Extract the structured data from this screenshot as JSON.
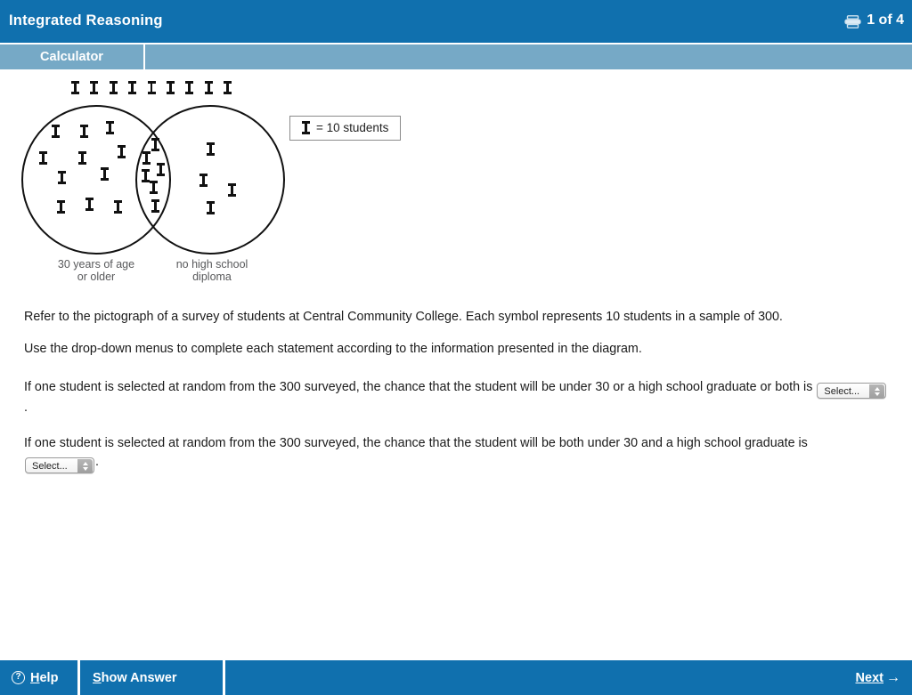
{
  "header": {
    "title": "Integrated Reasoning",
    "printer_icon": "printer-icon",
    "page_counter": "1 of 4"
  },
  "tabbar": {
    "tabs": [
      {
        "label": "Calculator",
        "active": true
      }
    ]
  },
  "pictograph": {
    "legend_symbol": "student-symbol-icon",
    "legend_text": "= 10 students",
    "left_label": "30 years of age\nor older",
    "left_label_line1": "30 years of age",
    "left_label_line2": "or older",
    "right_label_line1": "no high school",
    "right_label_line2": "diploma",
    "counts": {
      "outside_both": 9,
      "left_only": 11,
      "intersection": 6,
      "right_only": 4
    }
  },
  "chart_data": {
    "type": "pie",
    "title": "Survey of students at Central Community College",
    "subtitle": "Each symbol represents 10 students in a sample of 300",
    "symbol_value": 10,
    "total_students": 300,
    "categories": [
      "30 years of age or older (only)",
      "both 30 or older and no high school diploma",
      "no high school diploma (only)",
      "neither (outside both circles)"
    ],
    "symbol_counts": [
      11,
      6,
      4,
      9
    ],
    "values": [
      110,
      60,
      40,
      90
    ],
    "set_labels": [
      "30 years of age or older",
      "no high school diploma"
    ],
    "legend": "Ⅸ = 10 students",
    "xlabel": "",
    "ylabel": "students"
  },
  "body": {
    "intro": "Refer to the pictograph of a survey of students at Central Community College. Each symbol represents 10 students in a sample of 300.",
    "instruction": "Use the drop-down menus to complete each statement according to the information presented in the diagram.",
    "statement1_before": "If one student is selected at random from the 300 surveyed, the chance that the student will be under 30 or a high school graduate or both is",
    "statement1_after": ".",
    "statement2_before": "If one student is selected at random from the 300 surveyed, the chance that the student will be both under 30 and a high school graduate is",
    "statement2_after": "."
  },
  "dropdowns": [
    {
      "name": "statement1-select",
      "value": "Select..."
    },
    {
      "name": "statement2-select",
      "value": "Select..."
    }
  ],
  "footer": {
    "help_label": "Help",
    "help_accesskey": "H",
    "show_answer_label": "Show Answer",
    "show_answer_accesskey": "S",
    "next_label": "Next",
    "next_accesskey": "N",
    "next_arrow": "→"
  },
  "colors": {
    "header_blue": "#1070ae",
    "tab_blue": "#76a9c6",
    "page_bg": "#ffffff",
    "text": "#1a1a1a",
    "label_gray": "#58595b"
  }
}
